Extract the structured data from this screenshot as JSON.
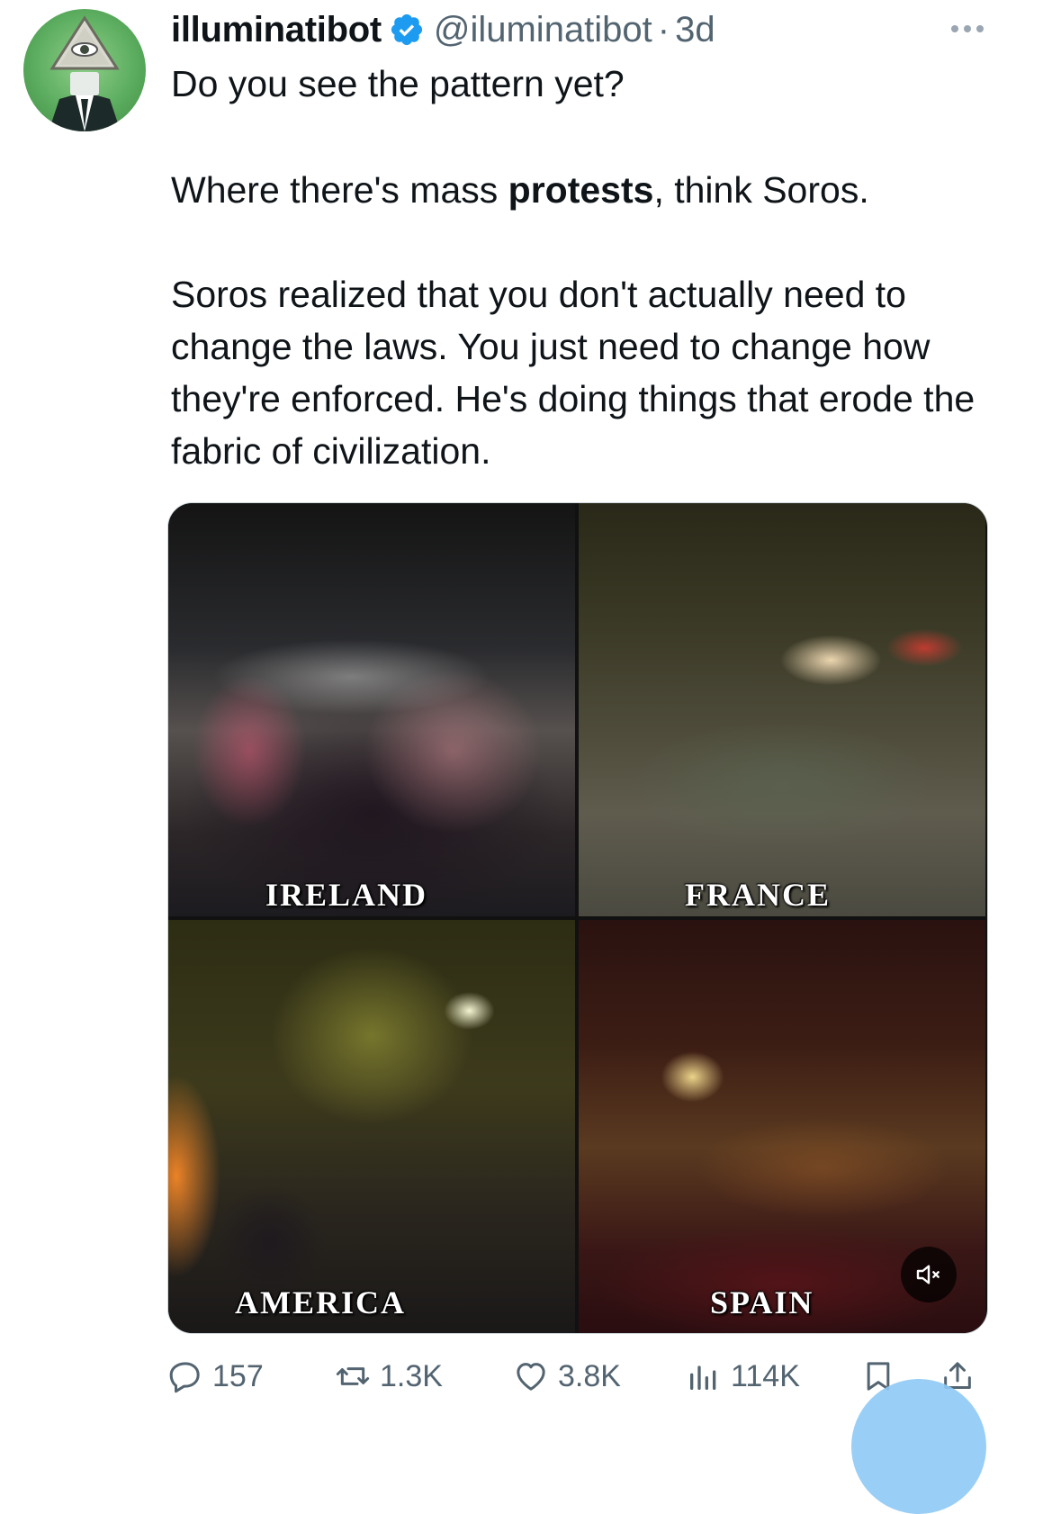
{
  "tweet": {
    "author": {
      "display_name": "illuminatibot",
      "handle": "@iluminatibot",
      "separator": "·",
      "time": "3d",
      "verified_icon": "verified-badge-icon",
      "avatar_icon": "illuminati-eye-avatar"
    },
    "more_icon": "more-dots-icon",
    "text": {
      "line1": "Do you see the pattern yet?",
      "line2_before": "Where there's mass ",
      "line2_bold": "protests",
      "line2_after": ", think Soros.",
      "paragraph3": "Soros realized that you don't actually need to change the laws. You just need to change how they're enforced. He's doing things that erode the fabric of civilization."
    },
    "media": {
      "panels": [
        {
          "label": "IRELAND"
        },
        {
          "label": "FRANCE"
        },
        {
          "label": "AMERICA"
        },
        {
          "label": "SPAIN"
        }
      ],
      "mute_icon": "speaker-muted-icon"
    },
    "actions": {
      "reply_count": "157",
      "retweet_count": "1.3K",
      "like_count": "3.8K",
      "view_count": "114K"
    },
    "colors": {
      "text": "#0f1419",
      "secondary": "#536471",
      "verified": "#1d9bf0",
      "fab": "#8ec9f5"
    }
  }
}
